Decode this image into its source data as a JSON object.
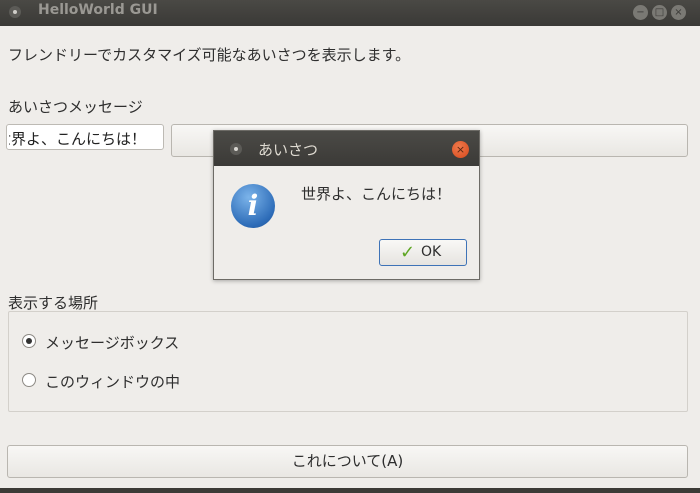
{
  "window": {
    "title": "HelloWorld GUI",
    "controls": [
      "−",
      "□",
      "×"
    ]
  },
  "main": {
    "description": "フレンドリーでカスタマイズ可能なあいさつを表示します。",
    "message_label": "あいさつメッセージ",
    "message_value": "世界よ、こんにちは！",
    "place_label": "表示する場所",
    "options": [
      {
        "label": "メッセージボックス",
        "selected": true
      },
      {
        "label": "このウィンドウの中",
        "selected": false
      }
    ],
    "about_button": "これについて(A)"
  },
  "dialog": {
    "title": "あいさつ",
    "message": "世界よ、こんにちは！",
    "ok_label": "OK",
    "icon": "info-icon",
    "close_icon": "×"
  }
}
